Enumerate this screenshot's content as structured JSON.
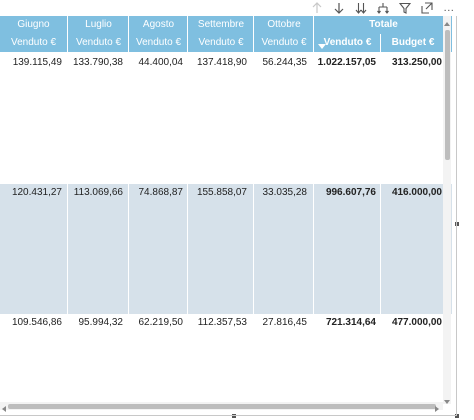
{
  "toolbar": {
    "icons": [
      "arrow-up-icon",
      "arrow-down-icon",
      "double-arrow-down-icon",
      "expand-hierarchy-icon",
      "filter-icon",
      "focus-mode-icon",
      "more-options-icon"
    ],
    "more_label": "..."
  },
  "table": {
    "months": [
      "Giugno",
      "Luglio",
      "Agosto",
      "Settembre",
      "Ottobre"
    ],
    "total_label": "Totale",
    "sub_headers": [
      "Venduto €",
      "Venduto €",
      "Venduto €",
      "Venduto €",
      "Venduto €",
      "Venduto €",
      "Budget €"
    ],
    "rows": [
      {
        "values": [
          "139.115,49",
          "133.790,38",
          "44.400,04",
          "137.418,90",
          "56.244,35",
          "1.022.157,05",
          "313.250,00"
        ],
        "shaded": false
      },
      {
        "values": [
          "120.431,27",
          "113.069,66",
          "74.868,87",
          "155.858,07",
          "33.035,28",
          "996.607,76",
          "416.000,00"
        ],
        "shaded": true
      },
      {
        "values": [
          "109.546,86",
          "95.994,32",
          "62.219,50",
          "112.357,53",
          "27.816,45",
          "721.314,64",
          "477.000,00"
        ],
        "shaded": false
      }
    ]
  },
  "colors": {
    "header_bg": "#7fbfe0",
    "band_bg": "#d6e1ea",
    "text": "#222222"
  }
}
